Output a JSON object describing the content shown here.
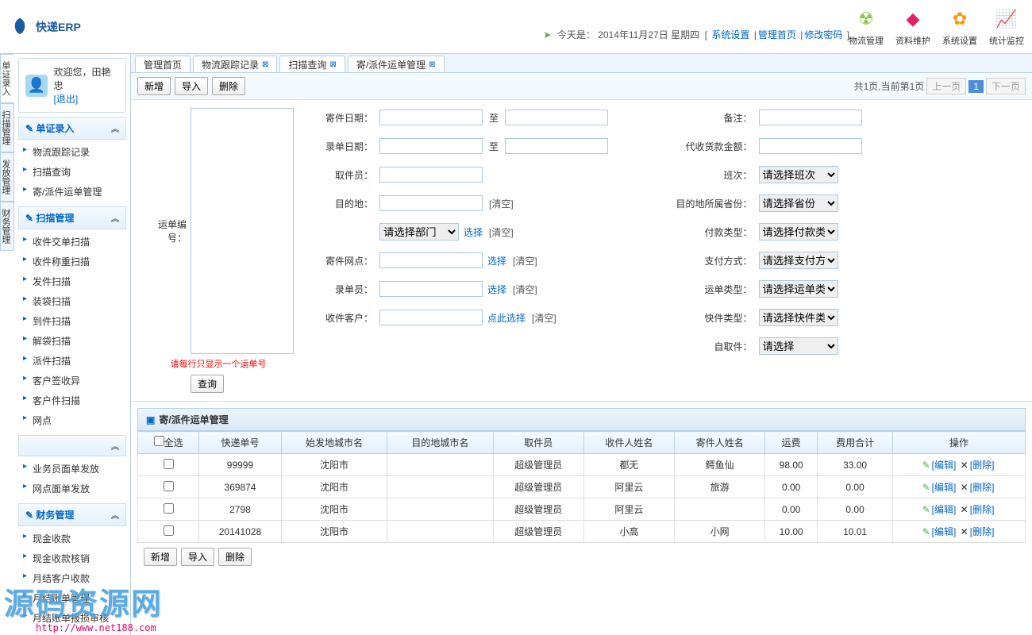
{
  "header": {
    "app_name": "快递ERP",
    "date_prefix": "今天是：",
    "date": "2014年11月27日 星期四",
    "links": [
      "系统设置",
      "管理首页",
      "修改密码"
    ],
    "nav": [
      {
        "icon": "☢",
        "label": "物流管理",
        "color": "#8bc34a"
      },
      {
        "icon": "◆",
        "label": "资料维护",
        "color": "#e91e63"
      },
      {
        "icon": "✿",
        "label": "系统设置",
        "color": "#ff9800"
      },
      {
        "icon": "📈",
        "label": "统计监控",
        "color": "#90a4ae"
      }
    ]
  },
  "user": {
    "welcome": "欢迎您，",
    "name": "田艳忠",
    "logout": "[退出]"
  },
  "vtabs": [
    "单证录入",
    "扫描管理",
    "发放管理",
    "财务管理"
  ],
  "menu": [
    {
      "title": "单证录入",
      "chev": "︽",
      "items": [
        "物流跟踪记录",
        "扫描查询",
        "寄/派件运单管理"
      ]
    },
    {
      "title": "扫描管理",
      "chev": "︽",
      "items": [
        "收件交单扫描",
        "收件称重扫描",
        "发件扫描",
        "装袋扫描",
        "到件扫描",
        "解袋扫描",
        "派件扫描",
        "客户签收异",
        "客户件扫描",
        "网点"
      ]
    },
    {
      "title_blank": true,
      "chev": "︽",
      "items": [
        "业务员面单发放",
        "网点面单发放"
      ]
    },
    {
      "title": "财务管理",
      "chev": "︽",
      "items": [
        "现金收款",
        "现金收款核销",
        "月结客户收款",
        "月结账单管理",
        "月结账单报损审核"
      ]
    }
  ],
  "tabs": [
    "管理首页",
    "物流跟踪记录",
    "扫描查询",
    "寄/派件运单管理"
  ],
  "toolbar": {
    "add": "新增",
    "import": "导入",
    "delete": "删除"
  },
  "pager": {
    "info": "共1页,当前第1页",
    "prev": "上一页",
    "page": "1",
    "next": "下一页"
  },
  "search": {
    "waybill_label": "运单编号：",
    "hint": "请每行只显示一个运单号",
    "query": "查询",
    "mid": [
      {
        "label": "寄件日期：",
        "type": "range",
        "sep": "至"
      },
      {
        "label": "录单日期：",
        "type": "range",
        "sep": "至"
      },
      {
        "label": "取件员：",
        "type": "text"
      },
      {
        "label": "目的地：",
        "type": "text",
        "clear": "[清空]"
      },
      {
        "label": "",
        "type": "select",
        "options": "请选择部门",
        "choose": "选择",
        "clear": "[清空]"
      },
      {
        "label": "寄件网点：",
        "type": "text",
        "choose": "选择",
        "clear": "[清空]"
      },
      {
        "label": "录单员：",
        "type": "text",
        "choose": "选择",
        "clear": "[清空]"
      },
      {
        "label": "收件客户：",
        "type": "text",
        "link": "点此选择",
        "clear": "[清空]"
      }
    ],
    "right": [
      {
        "label": "备注：",
        "type": "text"
      },
      {
        "label": "代收货款金额：",
        "type": "text"
      },
      {
        "label": "班次：",
        "type": "select",
        "options": "请选择班次"
      },
      {
        "label": "目的地所属省份：",
        "type": "select",
        "options": "请选择省份"
      },
      {
        "label": "付款类型：",
        "type": "select",
        "options": "请选择付款类型"
      },
      {
        "label": "支付方式：",
        "type": "select",
        "options": "请选择支付方式"
      },
      {
        "label": "运单类型：",
        "type": "select",
        "options": "请选择运单类型"
      },
      {
        "label": "快件类型：",
        "type": "select",
        "options": "请选择快件类型"
      },
      {
        "label": "自取件：",
        "type": "select",
        "options": "请选择"
      }
    ]
  },
  "table": {
    "title": "寄/派件运单管理",
    "headers": [
      "□全选",
      "快递单号",
      "始发地城市名",
      "目的地城市名",
      "取件员",
      "收件人姓名",
      "寄件人姓名",
      "运费",
      "费用合计",
      "操作"
    ],
    "rows": [
      [
        "",
        "99999",
        "沈阳市",
        "",
        "超级管理员",
        "都无",
        "鳄鱼仙",
        "98.00",
        "33.00"
      ],
      [
        "",
        "369874",
        "沈阳市",
        "",
        "超级管理员",
        "阿里云",
        "旅游",
        "0.00",
        "0.00"
      ],
      [
        "",
        "2798",
        "沈阳市",
        "",
        "超级管理员",
        "阿里云",
        "",
        "0.00",
        "0.00"
      ],
      [
        "",
        "20141028",
        "沈阳市",
        "",
        "超级管理员",
        "小高",
        "小网",
        "10.00",
        "10.01"
      ]
    ],
    "edit": "[编辑]",
    "del": "[删除]"
  },
  "watermark": "源码资源网",
  "watermark_url": "http://www.net188.com"
}
